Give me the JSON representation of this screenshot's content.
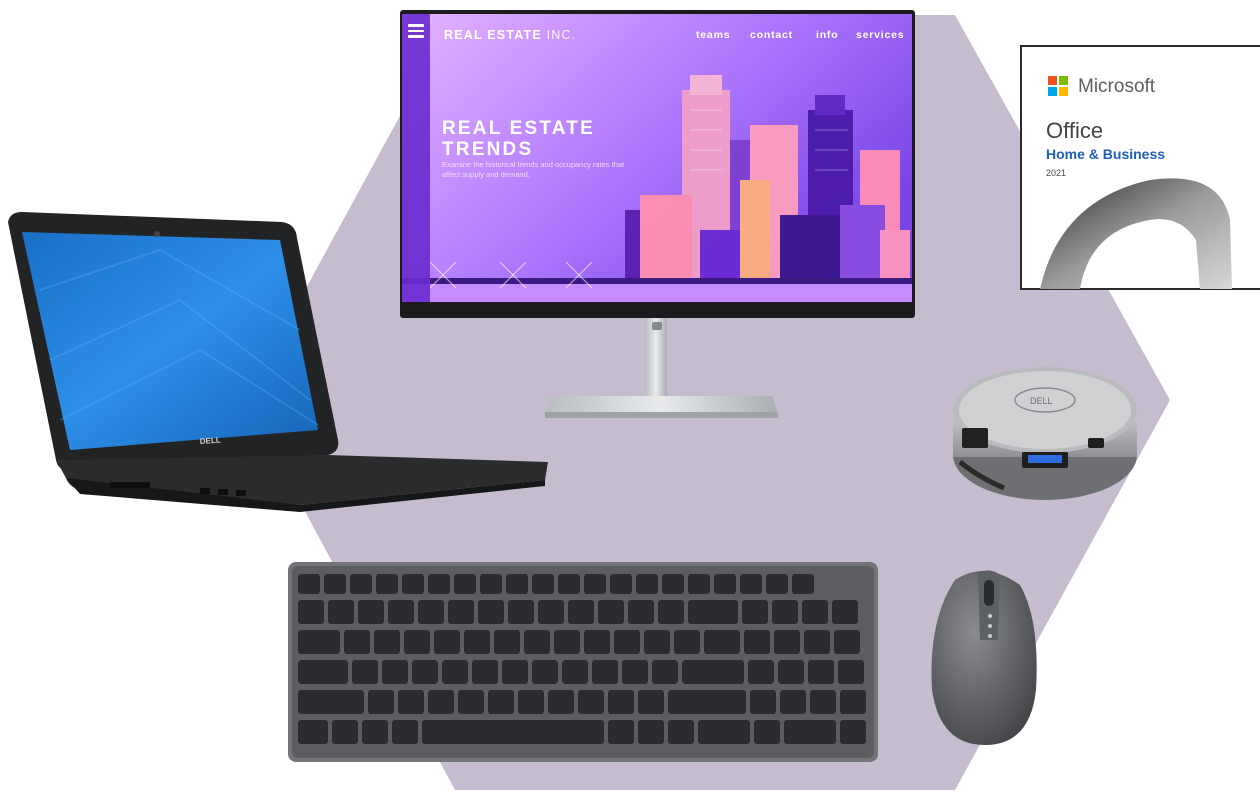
{
  "monitor_screen": {
    "brand_bold": "REAL ESTATE",
    "brand_light": " INC.",
    "nav": [
      "teams",
      "contact",
      "info",
      "services"
    ],
    "hero_title": "REAL ESTATE\nTRENDS",
    "hero_subtitle": "Examine the historical trends and occupancy rates that affect supply and demand.",
    "menu_icon": "hamburger-icon"
  },
  "office_box": {
    "brand": "Microsoft",
    "product": "Office",
    "edition": "Home & Business",
    "year": "2021",
    "logo_icon": "windows-four-squares-icon"
  },
  "device_brand": "DELL",
  "colors": {
    "hexagon": "#c6bccf",
    "screen_gradient_start": "#d6a6ff",
    "screen_gradient_end": "#7a3fe0",
    "device_dark": "#2a2a2a",
    "keyboard_gray": "#6c6d70",
    "office_blue": "#1f5fb8"
  }
}
